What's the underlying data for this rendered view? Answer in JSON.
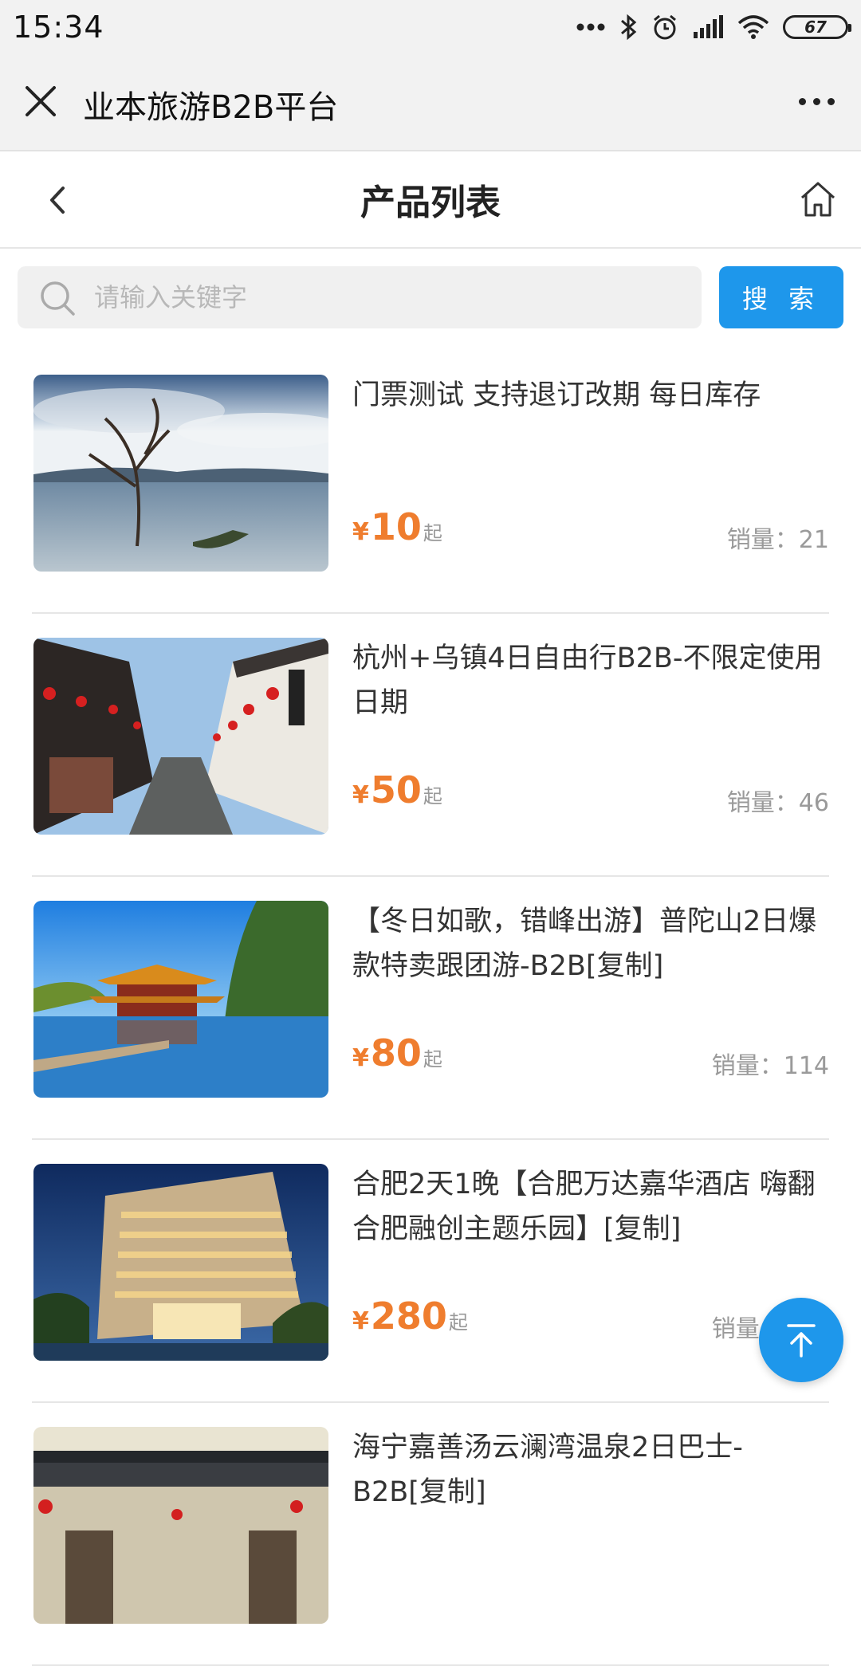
{
  "status_bar": {
    "time": "15:34",
    "battery": "67"
  },
  "webview": {
    "title": "业本旅游B2B平台"
  },
  "nav": {
    "title": "产品列表"
  },
  "search": {
    "placeholder": "请输入关键字",
    "button_label": "搜 索"
  },
  "products": [
    {
      "title": "门票测试 支持退订改期 每日库存",
      "currency": "¥",
      "price": "10",
      "price_suffix": "起",
      "sales": "销量：21"
    },
    {
      "title": "杭州+乌镇4日自由行B2B-不限定使用日期",
      "currency": "¥",
      "price": "50",
      "price_suffix": "起",
      "sales": "销量：46"
    },
    {
      "title": "【冬日如歌，错峰出游】普陀山2日爆款特卖跟团游-B2B[复制]",
      "currency": "¥",
      "price": "80",
      "price_suffix": "起",
      "sales": "销量：114"
    },
    {
      "title": "合肥2天1晚【合肥万达嘉华酒店 嗨翻合肥融创主题乐园】[复制]",
      "currency": "¥",
      "price": "280",
      "price_suffix": "起",
      "sales": "销量：134"
    },
    {
      "title": "海宁嘉善汤云澜湾温泉2日巴士-B2B[复制]",
      "currency": "",
      "price": "",
      "price_suffix": "",
      "sales": ""
    }
  ],
  "icons": {
    "close": "close-icon",
    "more": "more-icon",
    "back": "chevron-left-icon",
    "home": "home-icon",
    "search": "search-icon",
    "to_top": "arrow-up-icon"
  },
  "colors": {
    "accent": "#1e97eb",
    "price": "#ef7d2e"
  }
}
